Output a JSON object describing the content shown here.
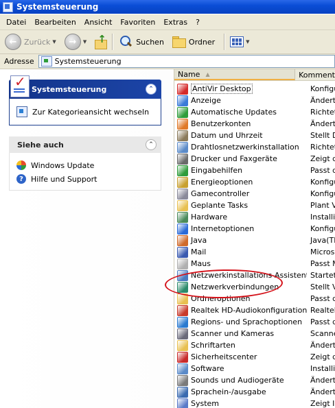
{
  "window": {
    "title": "Systemsteuerung"
  },
  "menu": [
    "Datei",
    "Bearbeiten",
    "Ansicht",
    "Favoriten",
    "Extras",
    "?"
  ],
  "toolbar": {
    "back_label": "Zurück",
    "search_label": "Suchen",
    "folders_label": "Ordner"
  },
  "address": {
    "label": "Adresse",
    "value": "Systemsteuerung"
  },
  "task_pane": {
    "control_panel": {
      "title": "Systemsteuerung",
      "collapse": "⌃",
      "link": "Zur Kategorieansicht wechseln"
    },
    "see_also": {
      "title": "Siehe auch",
      "collapse": "⌃",
      "links": [
        "Windows Update",
        "Hilfe und Support"
      ]
    }
  },
  "list": {
    "columns": {
      "name": "Name",
      "comment": "Komment"
    },
    "sort_arrow": "▲",
    "items": [
      {
        "name": "AntiVir Desktop",
        "comment": "Konfigu",
        "color": "#d42a2a"
      },
      {
        "name": "Anzeige",
        "comment": "Ändert",
        "color": "#3a7ad8"
      },
      {
        "name": "Automatische Updates",
        "comment": "Richtet",
        "color": "#2f9d3a"
      },
      {
        "name": "Benutzerkonten",
        "comment": "Ändert",
        "color": "#e07a2a"
      },
      {
        "name": "Datum und Uhrzeit",
        "comment": "Stellt D",
        "color": "#8a7a5a"
      },
      {
        "name": "Drahtlosnetzwerkinstallation",
        "comment": "Richtet",
        "color": "#5a8ac8"
      },
      {
        "name": "Drucker und Faxgeräte",
        "comment": "Zeigt di",
        "color": "#6a6a6a"
      },
      {
        "name": "Eingabehilfen",
        "comment": "Passt d",
        "color": "#2e9c3a"
      },
      {
        "name": "Energieoptionen",
        "comment": "Konfigu",
        "color": "#c8a030"
      },
      {
        "name": "Gamecontroller",
        "comment": "Konfigu",
        "color": "#8a8a9a"
      },
      {
        "name": "Geplante Tasks",
        "comment": "Plant Vo",
        "color": "#e8c050"
      },
      {
        "name": "Hardware",
        "comment": "Installie",
        "color": "#4a8a5a"
      },
      {
        "name": "Internetoptionen",
        "comment": "Konfigu",
        "color": "#2a6ad8"
      },
      {
        "name": "Java",
        "comment": "Java(TM",
        "color": "#d06a2a"
      },
      {
        "name": "Mail",
        "comment": "Microso",
        "color": "#3a5ab0"
      },
      {
        "name": "Maus",
        "comment": "Passt M",
        "color": "#b0b0b0"
      },
      {
        "name": "Netzwerkinstallations-Assistent",
        "comment": "Startet",
        "color": "#4a7ac0"
      },
      {
        "name": "Netzwerkverbindungen",
        "comment": "Stellt Ve",
        "color": "#2a8a6a"
      },
      {
        "name": "Ordneroptionen",
        "comment": "Passt di",
        "color": "#e8c050"
      },
      {
        "name": "Realtek HD-Audiokonfiguration",
        "comment": "Realtek",
        "color": "#c83a2a"
      },
      {
        "name": "Regions- und Sprachoptionen",
        "comment": "Passt d",
        "color": "#2a7ad0"
      },
      {
        "name": "Scanner und Kameras",
        "comment": "Scanner",
        "color": "#6a6a7a"
      },
      {
        "name": "Schriftarten",
        "comment": "Ändert,",
        "color": "#e8c050"
      },
      {
        "name": "Sicherheitscenter",
        "comment": "Zeigt de",
        "color": "#c82a2a"
      },
      {
        "name": "Software",
        "comment": "Installie",
        "color": "#5a8ac8"
      },
      {
        "name": "Sounds und Audiogeräte",
        "comment": "Ändert",
        "color": "#7a7a7a"
      },
      {
        "name": "Sprachein-/ausgabe",
        "comment": "Ändert",
        "color": "#3a6ab0"
      },
      {
        "name": "System",
        "comment": "Zeigt I",
        "color": "#5a7ac8"
      }
    ]
  },
  "colors": {
    "titlebar": "#0a4dd6",
    "panel_header": "#1c45a8",
    "annotation": "#d4121a"
  }
}
